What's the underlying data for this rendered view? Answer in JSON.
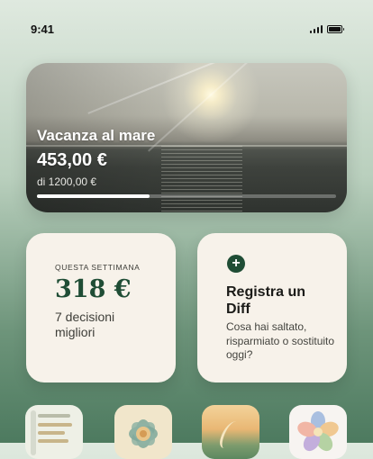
{
  "status_bar": {
    "time": "9:41"
  },
  "goal": {
    "title": "Vacanza al mare",
    "saved": "453,00 €",
    "target": "di 1200,00 €",
    "progress": 0.378
  },
  "week_card": {
    "label": "QUESTA SETTIMANA",
    "amount": "318 €",
    "description": "7 decisioni migliori"
  },
  "register_card": {
    "icon": "plus-icon",
    "title": "Registra un Diff",
    "subtitle": "Cosa hai saltato, risparmiato o sostituito oggi?"
  },
  "colors": {
    "accent": "#1f4d35",
    "card_bg": "#f7f2ea"
  },
  "shortcut_tiles": [
    {
      "icon": "notes-icon"
    },
    {
      "icon": "mandala-icon"
    },
    {
      "icon": "landscape-icon"
    },
    {
      "icon": "flower-icon"
    }
  ]
}
